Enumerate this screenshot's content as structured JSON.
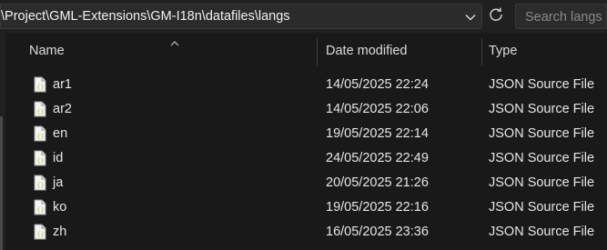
{
  "address_bar": {
    "path": "\\Project\\GML-Extensions\\GM-I18n\\datafiles\\langs"
  },
  "search": {
    "placeholder": "Search langs"
  },
  "columns": {
    "name": "Name",
    "date_modified": "Date modified",
    "type": "Type"
  },
  "sort": {
    "column": "name",
    "direction": "ascending"
  },
  "files": [
    {
      "name": "ar1",
      "date": "14/05/2025 22:24",
      "type": "JSON Source File"
    },
    {
      "name": "ar2",
      "date": "14/05/2025 22:06",
      "type": "JSON Source File"
    },
    {
      "name": "en",
      "date": "19/05/2025 22:14",
      "type": "JSON Source File"
    },
    {
      "name": "id",
      "date": "24/05/2025 22:49",
      "type": "JSON Source File"
    },
    {
      "name": "ja",
      "date": "20/05/2025 21:26",
      "type": "JSON Source File"
    },
    {
      "name": "ko",
      "date": "19/05/2025 22:16",
      "type": "JSON Source File"
    },
    {
      "name": "zh",
      "date": "16/05/2025 23:36",
      "type": "JSON Source File"
    }
  ],
  "icons": {
    "file": "json-file-icon",
    "refresh": "refresh-icon",
    "dropdown": "chevron-down-icon",
    "sort": "sort-ascending-icon"
  },
  "colors": {
    "background": "#191919",
    "icon_accent": "#c8d84a"
  }
}
